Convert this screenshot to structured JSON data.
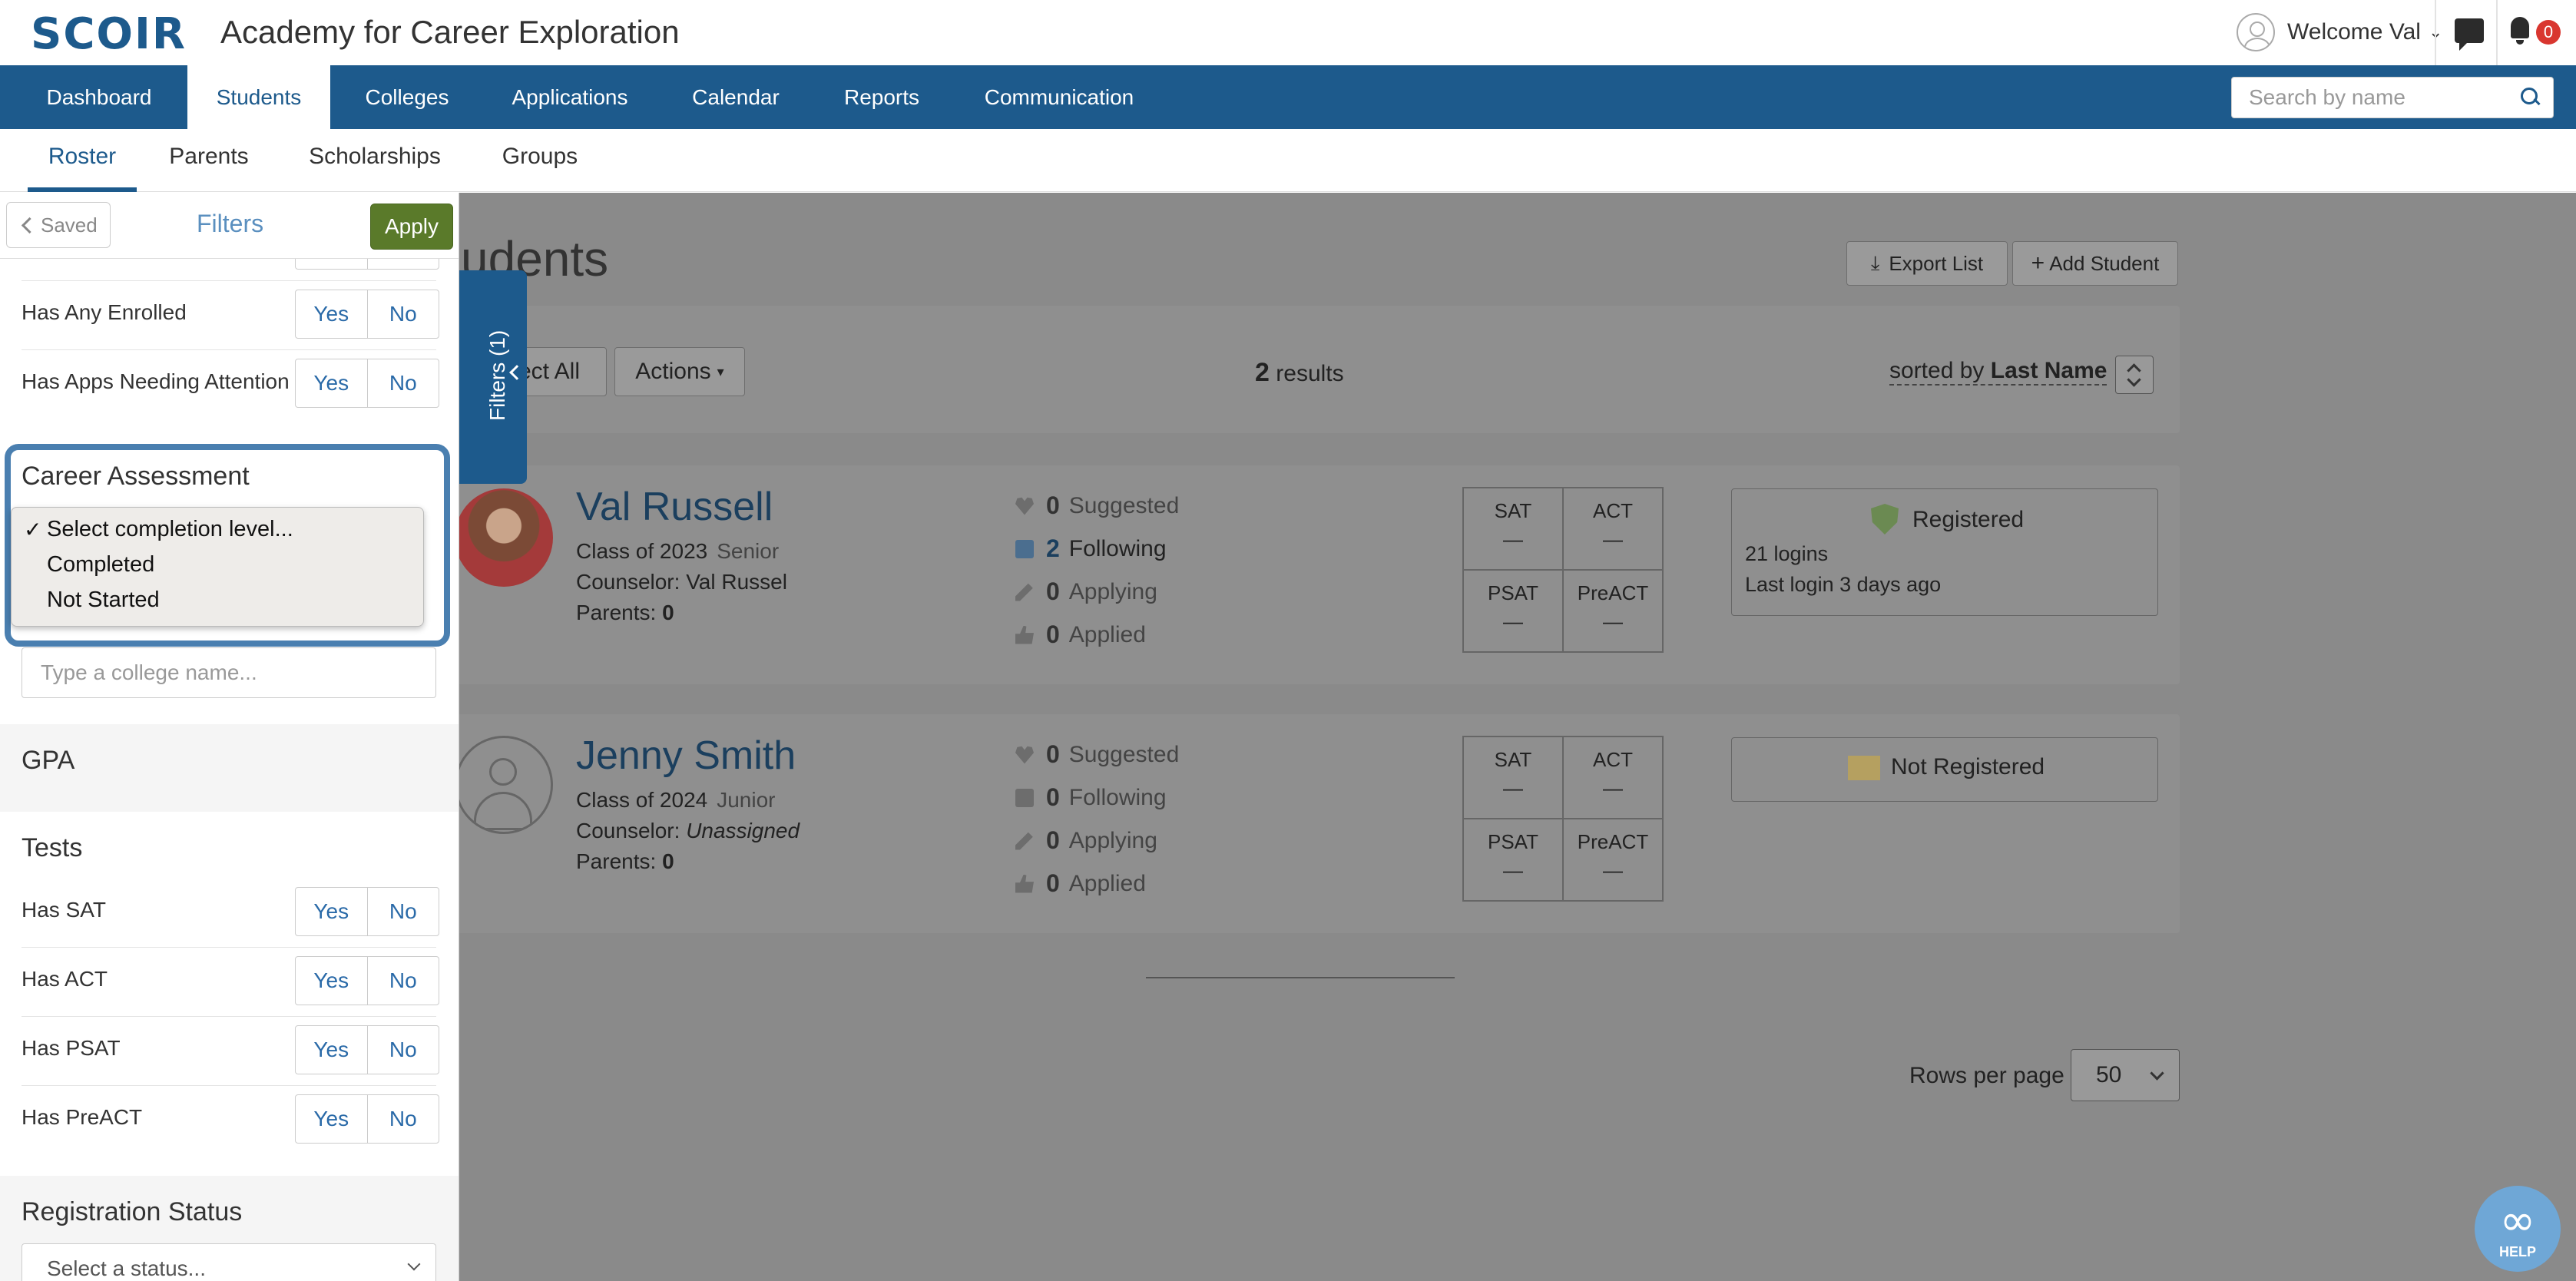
{
  "header": {
    "logo": "SCOIR",
    "org_title": "Academy for Career Exploration",
    "welcome": "Welcome Val",
    "notification_count": "0"
  },
  "nav": {
    "items": [
      "Dashboard",
      "Students",
      "Colleges",
      "Applications",
      "Calendar",
      "Reports",
      "Communication"
    ],
    "active": "Students",
    "search_placeholder": "Search by name"
  },
  "subnav": {
    "items": [
      "Roster",
      "Parents",
      "Scholarships",
      "Groups"
    ],
    "active": "Roster"
  },
  "main": {
    "heading_partial": "udents",
    "export_label": "Export List",
    "add_student_label": "Add Student",
    "select_all_partial": "ect All",
    "actions_label": "Actions",
    "results_count": "2",
    "results_label": "results",
    "sorted_by_label": "sorted by",
    "sorted_by_value": "Last Name",
    "rows_per_page_label": "Rows per page",
    "rows_per_page_value": "50"
  },
  "students": [
    {
      "name": "Val Russell",
      "class_of": "Class of 2023",
      "grade": "Senior",
      "counselor_label": "Counselor:",
      "counselor": "Val Russel",
      "parents_label": "Parents:",
      "parents": "0",
      "suggested": "0",
      "following": "2",
      "applying": "0",
      "applied": "0",
      "status": "Registered",
      "logins": "21 logins",
      "last_login": "Last login 3 days ago"
    },
    {
      "name": "Jenny Smith",
      "class_of": "Class of 2024",
      "grade": "Junior",
      "counselor_label": "Counselor:",
      "counselor": "Unassigned",
      "parents_label": "Parents:",
      "parents": "0",
      "suggested": "0",
      "following": "0",
      "applying": "0",
      "applied": "0",
      "status": "Not Registered"
    }
  ],
  "stat_labels": {
    "suggested": "Suggested",
    "following": "Following",
    "applying": "Applying",
    "applied": "Applied"
  },
  "score_labels": {
    "sat": "SAT",
    "act": "ACT",
    "psat": "PSAT",
    "preact": "PreACT",
    "empty": "—"
  },
  "sidebar": {
    "saved_label": "Saved",
    "title": "Filters",
    "apply_label": "Apply",
    "tab_label": "Filters (1)",
    "yes": "Yes",
    "no": "No",
    "enrolled_label": "Has Any Enrolled",
    "attention_label": "Has Apps Needing Attention",
    "career_title": "Career Assessment",
    "career_options": [
      "Select completion level...",
      "Completed",
      "Not Started"
    ],
    "college_placeholder": "Type a college name...",
    "gpa_title": "GPA",
    "tests_title": "Tests",
    "tests": [
      "Has SAT",
      "Has ACT",
      "Has PSAT",
      "Has PreACT"
    ],
    "registration_title": "Registration Status",
    "registration_placeholder": "Select a status..."
  },
  "help": {
    "label": "HELP"
  },
  "colors": {
    "brand": "#1d5a8c",
    "apply": "#5a7a2a",
    "badge": "#d9362f",
    "highlight": "#4a7fb0"
  }
}
